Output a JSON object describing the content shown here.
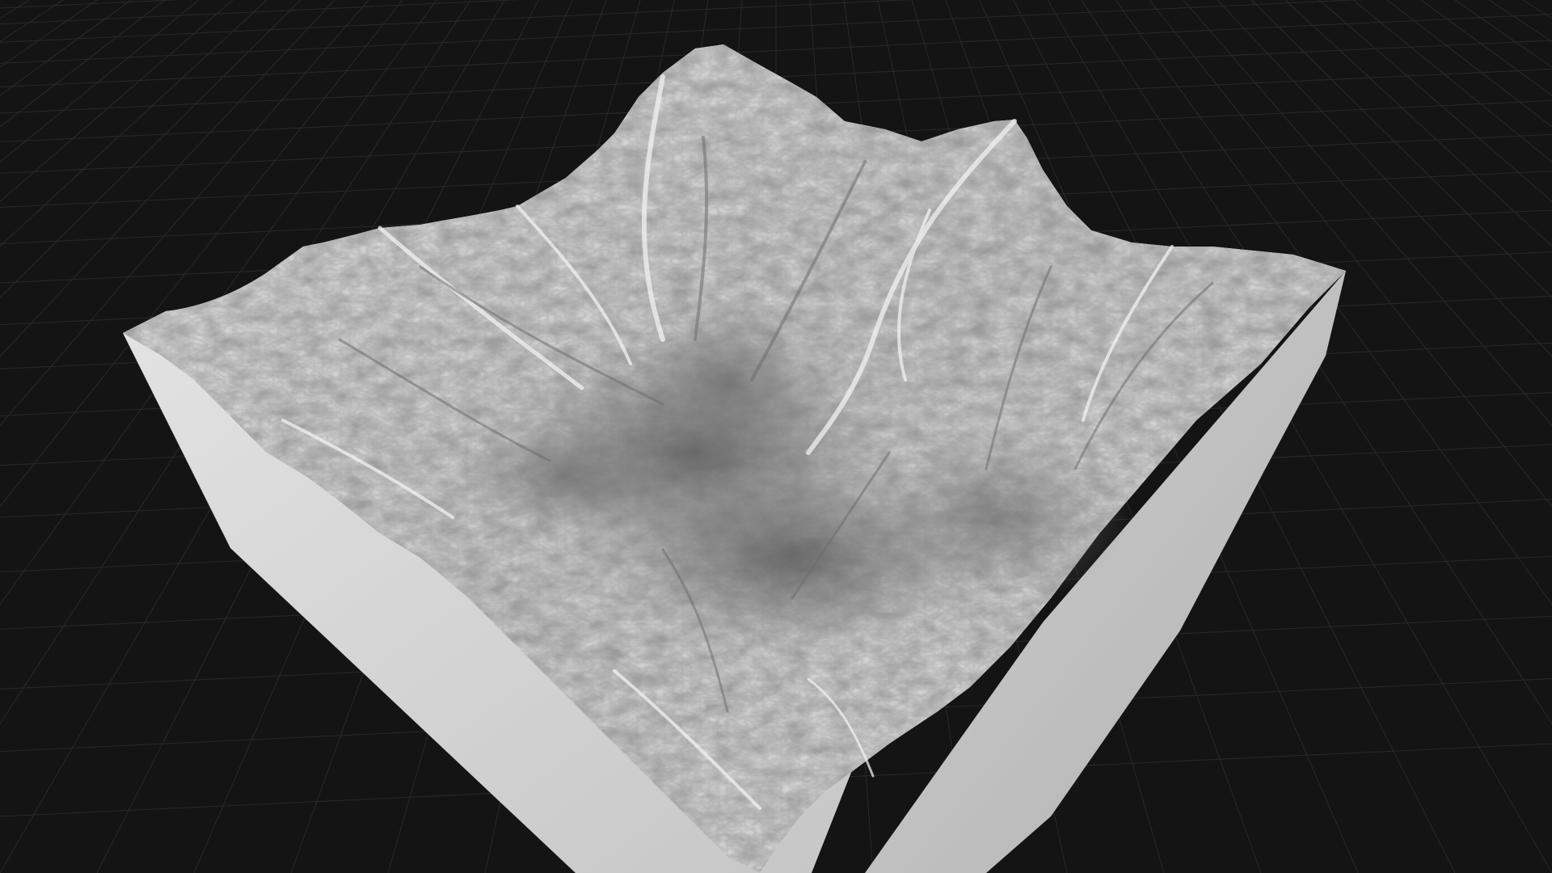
{
  "viewport": {
    "background_color": "#141414",
    "grid_color": "#2a2a2a",
    "grid_visible": true
  },
  "terrain": {
    "top_color": "#dcdcdc",
    "valley_shade_color": "#5a5a5a",
    "ridge_highlight_color": "#f4f4f4",
    "side_left_color": "#d4d4d4",
    "side_right_color": "#bdbdbd"
  }
}
